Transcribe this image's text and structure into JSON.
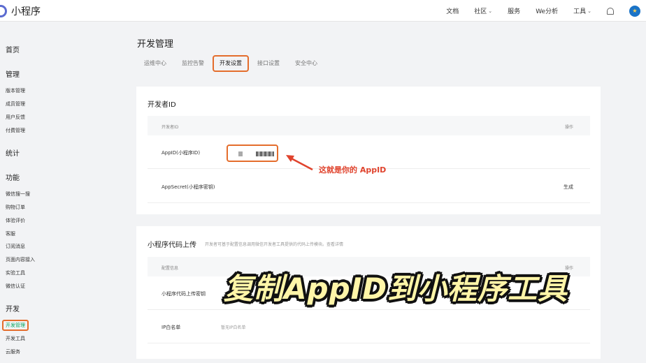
{
  "app": {
    "title": "小程序"
  },
  "topnav": {
    "docs": "文档",
    "community": "社区",
    "services": "服务",
    "we_analysis": "We分析",
    "tools": "工具"
  },
  "sidebar": {
    "home": "首页",
    "manage_title": "管理",
    "manage_items": [
      "版本管理",
      "成员管理",
      "用户反馈",
      "付费管理"
    ],
    "stats_title": "统计",
    "features_title": "功能",
    "feature_items": [
      "微信搜一搜",
      "购物订单",
      "体验评价",
      "客服",
      "订阅消息",
      "页面内容接入",
      "实验工具",
      "微信认证"
    ],
    "dev_title": "开发",
    "dev_items": [
      "开发管理",
      "开发工具",
      "云服务"
    ]
  },
  "main": {
    "title": "开发管理",
    "tabs": [
      "运维中心",
      "监控告警",
      "开发设置",
      "接口设置",
      "安全中心"
    ],
    "developer_id": {
      "title": "开发者ID",
      "col_left": "开发者ID",
      "col_right": "操作",
      "rows": [
        {
          "label": "AppID(小程序ID)",
          "action": ""
        },
        {
          "label": "AppSecret(小程序密钥)",
          "action": "生成"
        }
      ]
    },
    "upload": {
      "title": "小程序代码上传",
      "note": "开发者可基于配置信息调用微信开发者工具提供的代码上传模块。查看详情",
      "col_left": "配置信息",
      "col_right": "操作",
      "rows": [
        {
          "label": "小程序代码上传密钥",
          "value": ""
        },
        {
          "label": "IP白名单",
          "value": "暂无IP白名单"
        }
      ]
    }
  },
  "annotations": {
    "callout": "这就是你的 AppID",
    "overlay": "复制AppID到小程序工具"
  }
}
